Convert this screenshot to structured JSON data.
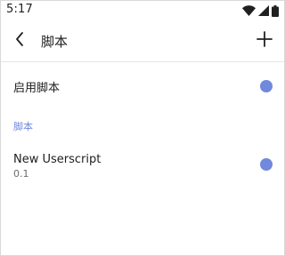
{
  "status_bar": {
    "time": "5:17",
    "icons": [
      "wifi-icon",
      "cellular-signal-icon",
      "battery-icon"
    ]
  },
  "app_bar": {
    "back_icon": "chevron-left-icon",
    "title": "脚本",
    "add_icon": "plus-icon"
  },
  "settings": {
    "enable_scripts_label": "启用脚本",
    "enable_scripts_on": true
  },
  "scripts_section": {
    "header": "脚本",
    "items": [
      {
        "name": "New Userscript",
        "version": "0.1",
        "enabled": true
      }
    ]
  },
  "colors": {
    "accent": "#7089dd",
    "text_primary": "#202020",
    "text_secondary": "#6b6b6b",
    "divider": "#e6e6e6"
  }
}
